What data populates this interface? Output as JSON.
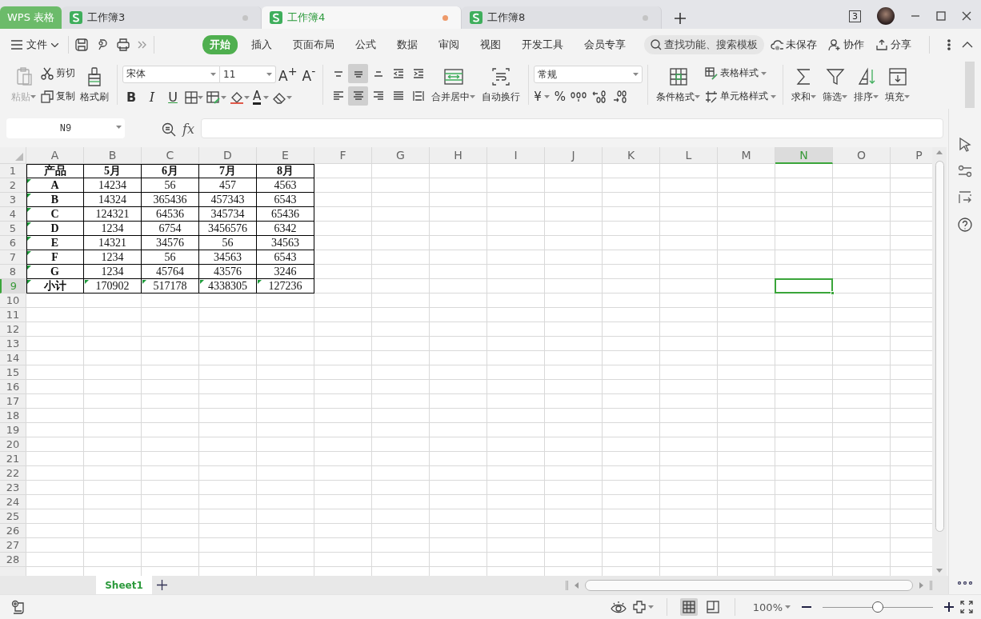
{
  "app_tabs": [
    {
      "kind": "brand",
      "label": "WPS 表格"
    },
    {
      "kind": "document",
      "label": "工作簿3",
      "selected": false
    },
    {
      "kind": "document",
      "label": "工作簿4",
      "selected": true
    },
    {
      "kind": "document",
      "label": "工作簿8",
      "selected": false
    }
  ],
  "window_count": "3",
  "menu": {
    "file": "文件",
    "tabs": [
      {
        "label": "开始",
        "selected": true
      },
      {
        "label": "插入",
        "selected": false
      },
      {
        "label": "页面布局",
        "selected": false
      },
      {
        "label": "公式",
        "selected": false
      },
      {
        "label": "数据",
        "selected": false
      },
      {
        "label": "审阅",
        "selected": false
      },
      {
        "label": "视图",
        "selected": false
      },
      {
        "label": "开发工具",
        "selected": false
      },
      {
        "label": "会员专享",
        "selected": false
      }
    ],
    "search_placeholder": "查找功能、搜索模板",
    "actions": [
      "未保存",
      "协作",
      "分享"
    ]
  },
  "ribbon": {
    "paste": {
      "label": "粘贴",
      "disabled": true
    },
    "cut": "剪切",
    "copy": "复制",
    "format_painter": "格式刷",
    "font": "宋体",
    "font_size": "11",
    "grow_font": "A$^{+}$",
    "shrink_font": "A$^{-}$",
    "bold": "B",
    "italic": "I",
    "underline": "U",
    "font_color": "A",
    "alignment": [
      {
        "selected": false
      },
      {
        "selected": true
      },
      {
        "selected": false
      },
      {
        "selected": false
      },
      {
        "selected": false
      },
      {
        "selected": false
      },
      {
        "selected": true
      },
      {
        "selected": false
      },
      {
        "selected": false
      },
      {
        "selected": false
      }
    ],
    "merge": "合并居中",
    "wrap": "自动换行",
    "number_format": "常规",
    "currency": "¥",
    "percent": "%",
    "conditional_format": "条件格式",
    "table_style": "表格样式",
    "cell_style": "单元格样式",
    "sum": "求和",
    "filter": "筛选",
    "sort": "排序",
    "fill": "填充"
  },
  "formula_bar": {
    "name_box": "N9",
    "fx": "fx"
  },
  "sheet": {
    "columns": [
      {
        "label": "A",
        "selected": false
      },
      {
        "label": "B",
        "selected": false
      },
      {
        "label": "C",
        "selected": false
      },
      {
        "label": "D",
        "selected": false
      },
      {
        "label": "E",
        "selected": false
      },
      {
        "label": "F",
        "selected": false
      },
      {
        "label": "G",
        "selected": false
      },
      {
        "label": "H",
        "selected": false
      },
      {
        "label": "I",
        "selected": false
      },
      {
        "label": "J",
        "selected": false
      },
      {
        "label": "K",
        "selected": false
      },
      {
        "label": "L",
        "selected": false
      },
      {
        "label": "M",
        "selected": false
      },
      {
        "label": "N",
        "selected": true
      },
      {
        "label": "O",
        "selected": false
      },
      {
        "label": "P",
        "selected": false
      }
    ],
    "rows": [
      {
        "label": "1",
        "selected": false
      },
      {
        "label": "2",
        "selected": false
      },
      {
        "label": "3",
        "selected": false
      },
      {
        "label": "4",
        "selected": false
      },
      {
        "label": "5",
        "selected": false
      },
      {
        "label": "6",
        "selected": false
      },
      {
        "label": "7",
        "selected": false
      },
      {
        "label": "8",
        "selected": false
      },
      {
        "label": "9",
        "selected": true
      },
      {
        "label": "10",
        "selected": false
      },
      {
        "label": "11",
        "selected": false
      },
      {
        "label": "12",
        "selected": false
      },
      {
        "label": "13",
        "selected": false
      },
      {
        "label": "14",
        "selected": false
      },
      {
        "label": "15",
        "selected": false
      },
      {
        "label": "16",
        "selected": false
      },
      {
        "label": "17",
        "selected": false
      },
      {
        "label": "18",
        "selected": false
      },
      {
        "label": "19",
        "selected": false
      },
      {
        "label": "20",
        "selected": false
      },
      {
        "label": "21",
        "selected": false
      },
      {
        "label": "22",
        "selected": false
      },
      {
        "label": "23",
        "selected": false
      },
      {
        "label": "24",
        "selected": false
      },
      {
        "label": "25",
        "selected": false
      },
      {
        "label": "26",
        "selected": false
      },
      {
        "label": "27",
        "selected": false
      },
      {
        "label": "28",
        "selected": false
      }
    ],
    "table": [
      {
        "cells": [
          "产品",
          "5月",
          "6月",
          "7月",
          "8月"
        ],
        "flags": [
          false,
          false,
          false,
          false,
          false
        ]
      },
      {
        "cells": [
          "A",
          "14234",
          "56",
          "457",
          "4563"
        ],
        "flags": [
          true,
          false,
          false,
          false,
          false
        ]
      },
      {
        "cells": [
          "B",
          "14324",
          "365436",
          "457343",
          "6543"
        ],
        "flags": [
          true,
          false,
          false,
          false,
          false
        ]
      },
      {
        "cells": [
          "C",
          "124321",
          "64536",
          "345734",
          "65436"
        ],
        "flags": [
          true,
          false,
          false,
          false,
          false
        ]
      },
      {
        "cells": [
          "D",
          "1234",
          "6754",
          "3456576",
          "6342"
        ],
        "flags": [
          true,
          false,
          false,
          false,
          false
        ]
      },
      {
        "cells": [
          "E",
          "14321",
          "34576",
          "56",
          "34563"
        ],
        "flags": [
          true,
          false,
          false,
          false,
          false
        ]
      },
      {
        "cells": [
          "F",
          "1234",
          "56",
          "34563",
          "6543"
        ],
        "flags": [
          true,
          false,
          false,
          false,
          false
        ]
      },
      {
        "cells": [
          "G",
          "1234",
          "45764",
          "43576",
          "3246"
        ],
        "flags": [
          true,
          false,
          false,
          false,
          false
        ]
      },
      {
        "cells": [
          "小计",
          "170902",
          "517178",
          "4338305",
          "127236"
        ],
        "flags": [
          true,
          true,
          true,
          true,
          true
        ]
      }
    ]
  },
  "sheet_tabs": [
    {
      "label": "Sheet1",
      "selected": true
    }
  ],
  "status_bar": {
    "views": [
      {
        "selected": true
      },
      {
        "selected": false
      }
    ],
    "zoom": "100%",
    "zoom_slider": {
      "level": 0.5
    }
  }
}
